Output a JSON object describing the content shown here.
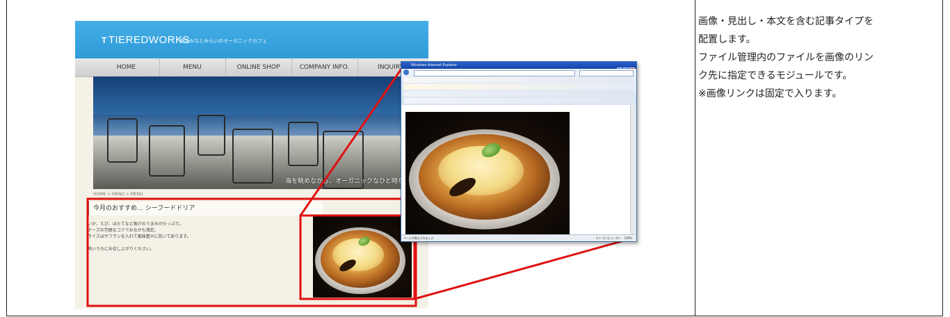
{
  "description_panel": {
    "lines": [
      "画像・見出し・本文を含む記事タイプを",
      "配置します。",
      "ファイル管理内のファイルを画像のリン",
      "ク先に指定できるモジュールです。",
      "※画像リンクは固定で入ります。"
    ]
  },
  "site": {
    "logo": "TIEREDWORKS",
    "logo_mark": "T",
    "tagline": "横浜みなとみらいのオーガニックカフェ",
    "nav": [
      "HOME",
      "MENU",
      "ONLINE SHOP",
      "COMPANY INFO.",
      "INQUIRY"
    ],
    "hero_caption": "海を眺めながら、オーガニックなひと時を過ごす",
    "breadcrumb": "HOME > MENU > MENU",
    "article": {
      "title": "今月のおすすめ… シーフードドリア",
      "body": [
        "いか、えび、ほたてなど魚介のうまみがたっぷり。",
        "チーズの芳醇なコクでおなかも満足。",
        "ライスはサフランを入れて風味豊かに炊いてあります。",
        "",
        "熱いうちにお召し上がりください。"
      ]
    }
  },
  "popup_browser": {
    "title": "Windows Internet Explorer",
    "status_left": "ページが表示されました",
    "status_right": "マイ コンピューター",
    "zoom": "100%"
  },
  "colors": {
    "highlight": "#e01010",
    "header_blue": "#3aa7e2"
  }
}
